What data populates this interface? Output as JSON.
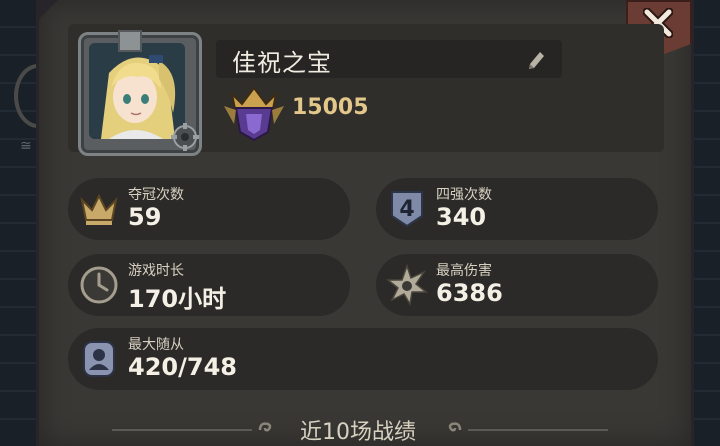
{
  "player": {
    "name": "佳祝之宝",
    "rank_score": "15005"
  },
  "stats": {
    "championships": {
      "label": "夺冠次数",
      "value": "59",
      "icon": "crown-icon"
    },
    "top4": {
      "label": "四强次数",
      "value": "340",
      "icon": "shield-four-icon"
    },
    "playtime": {
      "label": "游戏时长",
      "value": "170小时",
      "icon": "clock-icon"
    },
    "max_damage": {
      "label": "最高伤害",
      "value": "6386",
      "icon": "burst-icon"
    },
    "max_followers": {
      "label": "最大随从",
      "value": "420/748",
      "icon": "follower-icon"
    }
  },
  "footer": {
    "recent_title": "近10场战绩"
  },
  "colors": {
    "panel": "#3a3835",
    "card": "#2b2a28",
    "accent_gold": "#e3c78a",
    "close_red": "#6a3c34"
  }
}
